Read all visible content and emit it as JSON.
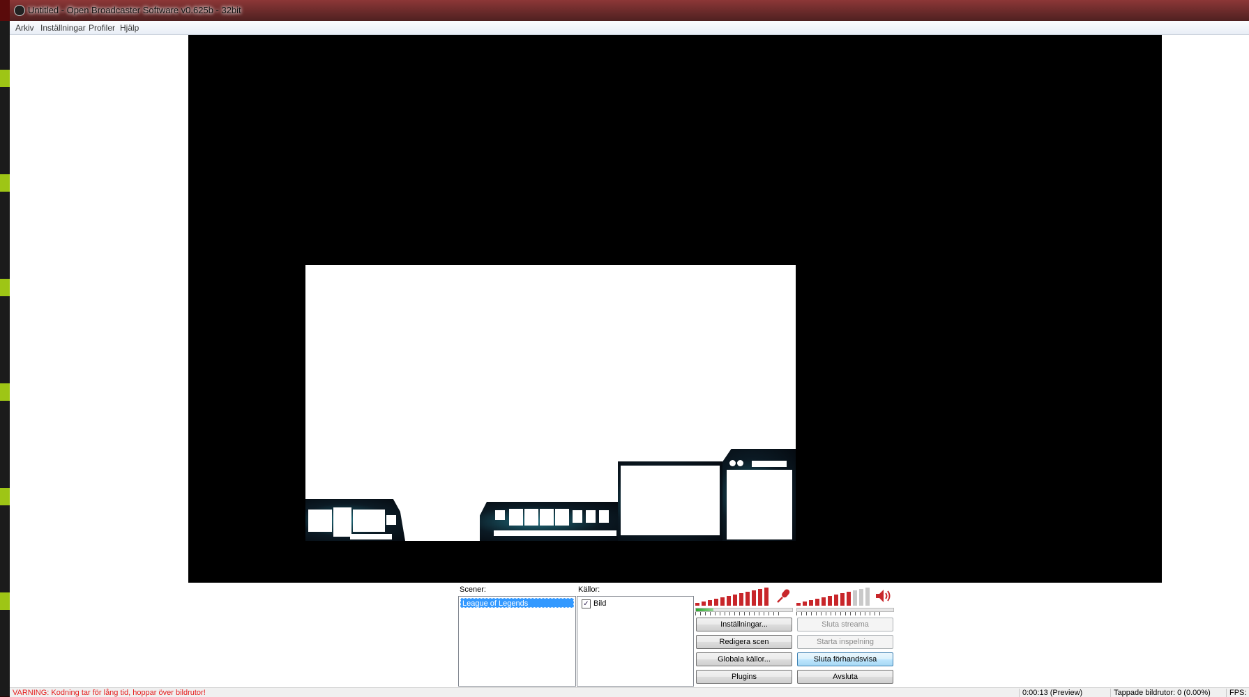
{
  "window": {
    "title": "Untitled - Open Broadcaster Software v0.625b - 32bit"
  },
  "menu": {
    "items": [
      "Arkiv",
      "Inställningar",
      "Profiler",
      "Hjälp"
    ]
  },
  "scenes": {
    "label": "Scener:",
    "items": [
      "League of Legends"
    ]
  },
  "sources": {
    "label": "Källor:",
    "items": [
      {
        "name": "Bild",
        "checked": true
      }
    ]
  },
  "audio": {
    "mic_icon": "microphone-icon",
    "speaker_icon": "speaker-icon",
    "mic_level": 1.0,
    "desktop_level": 0.75,
    "mic_slider": 0.18
  },
  "buttons": {
    "settings": "Inställningar...",
    "stop_stream": "Sluta streama",
    "edit_scene": "Redigera scen",
    "start_recording": "Starta inspelning",
    "global_sources": "Globala källor...",
    "stop_preview": "Sluta förhandsvisa",
    "plugins": "Plugins",
    "exit": "Avsluta"
  },
  "status": {
    "warning": "VARNING: Kodning tar för lång tid, hoppar över bildrutor!",
    "time": "0:00:13 (Preview)",
    "dropped": "Tappade bildrutor: 0 (0.00%)",
    "fps": "FPS:"
  },
  "colors": {
    "meter_red": "#c8262a",
    "selection_blue": "#3399ff",
    "warning_red": "#e51c1c"
  }
}
